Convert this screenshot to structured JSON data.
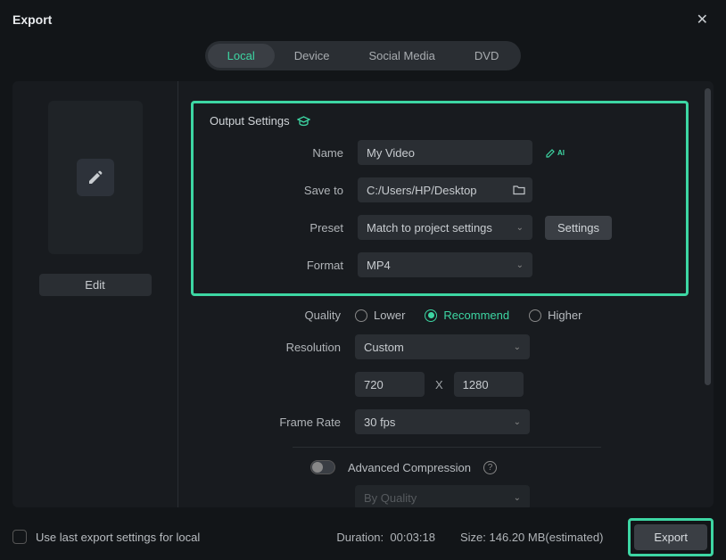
{
  "window": {
    "title": "Export"
  },
  "tabs": [
    "Local",
    "Device",
    "Social Media",
    "DVD"
  ],
  "active_tab": "Local",
  "sidebar": {
    "edit_label": "Edit"
  },
  "output": {
    "heading": "Output Settings",
    "name_label": "Name",
    "name_value": "My Video",
    "saveto_label": "Save to",
    "saveto_value": "C:/Users/HP/Desktop",
    "preset_label": "Preset",
    "preset_value": "Match to project settings",
    "settings_label": "Settings",
    "format_label": "Format",
    "format_value": "MP4"
  },
  "quality": {
    "label": "Quality",
    "options": [
      "Lower",
      "Recommend",
      "Higher"
    ],
    "selected": "Recommend"
  },
  "resolution": {
    "label": "Resolution",
    "preset": "Custom",
    "width": "720",
    "height": "1280",
    "x": "X"
  },
  "framerate": {
    "label": "Frame Rate",
    "value": "30 fps"
  },
  "advanced": {
    "label": "Advanced Compression",
    "subselect": "By Quality"
  },
  "footer": {
    "checkbox_label": "Use last export settings for local",
    "duration_label": "Duration:",
    "duration_value": "00:03:18",
    "size_label": "Size:",
    "size_value": "146.20 MB(estimated)",
    "export_label": "Export"
  }
}
